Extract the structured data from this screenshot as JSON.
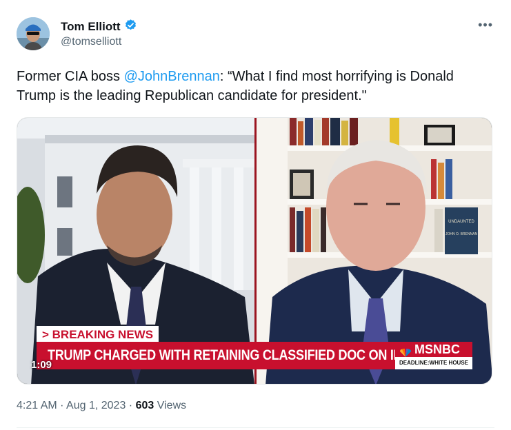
{
  "author": {
    "name": "Tom Elliott",
    "handle": "@tomselliott",
    "verified": true
  },
  "more_icon": "more-horizontal-icon",
  "text": {
    "prefix": "Former CIA boss ",
    "mention": "@JohnBrennan",
    "suffix": ": “What I find most horrifying is Donald Trump is the leading Republican candidate for president.\""
  },
  "media": {
    "breaking_label": "> BREAKING NEWS",
    "headline": "TRUMP CHARGED WITH RETAINING CLASSIFIED DOC ON IRAN",
    "network": "MSNBC",
    "show": "DEADLINE:WHITE HOUSE",
    "duration": "1:09",
    "book_title": "UNDAUNTED",
    "book_author": "JOHN O. BRENNAN"
  },
  "meta": {
    "time": "4:21 AM",
    "date": "Aug 1, 2023",
    "views_count": "603",
    "views_label": "Views"
  },
  "colors": {
    "accent": "#1d9bf0",
    "secondary_text": "#536471",
    "breaking_red": "#c8102e"
  }
}
